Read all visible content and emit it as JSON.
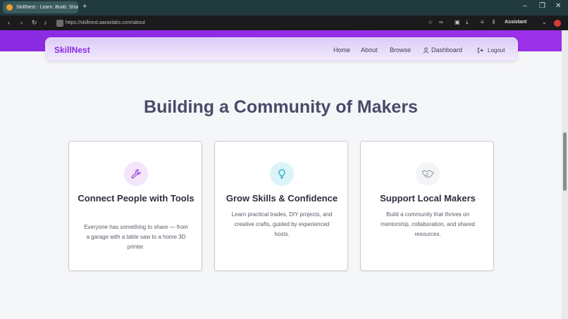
{
  "browser": {
    "tab_title": "SkillNest - Learn. Build. Share.",
    "new_tab": "+",
    "url": "https://skillnest.aaravlabs.com/about",
    "assistant_label": "Assistant",
    "window_controls": [
      "–",
      "❐",
      "✕"
    ]
  },
  "nav": {
    "brand": "SkillNest",
    "links": [
      "Home",
      "About",
      "Browse",
      "Dashboard",
      "Logout"
    ]
  },
  "main": {
    "headline": "Building a Community of Makers",
    "cards": [
      {
        "title": "Connect People with Tools",
        "text": "Everyone has something to share — from a garage with a table saw to a home 3D printer.",
        "icon": "wrench-icon",
        "icon_bg": "#f3e6fb",
        "icon_color": "#9b3fd8"
      },
      {
        "title": "Grow Skills & Confidence",
        "text": "Learn practical trades, DIY projects, and creative crafts, guided by experienced hosts.",
        "icon": "lightbulb-icon",
        "icon_bg": "#dcf3f9",
        "icon_color": "#1ba6c9"
      },
      {
        "title": "Support Local Makers",
        "text": "Build a community that thrives on mentorship, collaboration, and shared resources.",
        "icon": "handshake-icon",
        "icon_bg": "#f3f4f6",
        "icon_color": "#9a9ca3"
      }
    ]
  },
  "colors": {
    "brand": "#8a2be2",
    "headline": "#4a4a6a"
  }
}
